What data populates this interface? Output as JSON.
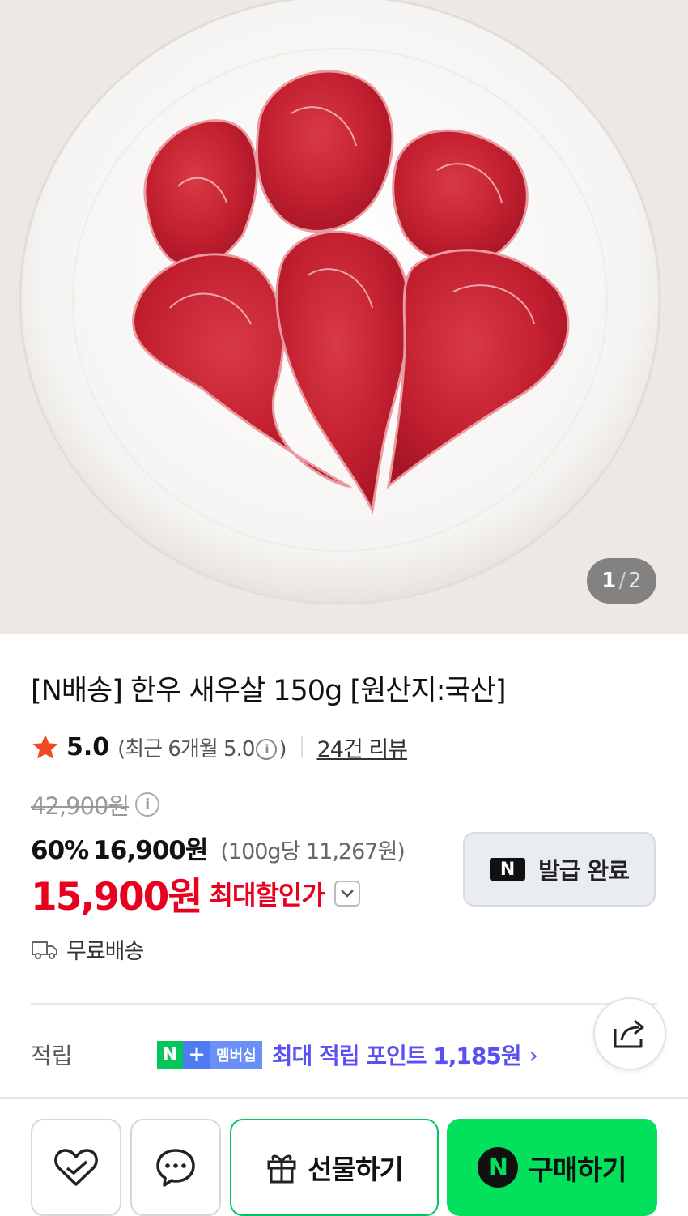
{
  "product_image": {
    "alt": "한우 새우살",
    "index": "1",
    "separator": "/",
    "total": "2"
  },
  "title": "[N배송] 한우 새우살 150g [원산지:국산]",
  "rating": {
    "score": "5.0",
    "recent": "(최근 6개월 5.0",
    "recent_close": ")",
    "info": "i",
    "reviews": "24건 리뷰"
  },
  "price": {
    "original": "42,900원",
    "info": "i",
    "discount": "60%",
    "sale": "16,900원",
    "unit": "(100g당 11,267원)",
    "final": "15,900원",
    "final_label": "최대할인가"
  },
  "coupon": {
    "badge": "N",
    "label": "발급 완료"
  },
  "shipping": {
    "label": "무료배송"
  },
  "points": {
    "label": "적립",
    "badge_n": "N",
    "badge_plus": "+",
    "badge_membership": "멤버십",
    "text": "최대 적립 포인트 1,185원",
    "arrow": "›"
  },
  "bottom_bar": {
    "gift_label": "선물하기",
    "buy_badge": "N",
    "buy_label": "구매하기"
  },
  "colors": {
    "accent_red": "#e8001f",
    "naver_green": "#03c75a",
    "buy_green": "#03e05b",
    "points_purple": "#5a4ff3"
  }
}
